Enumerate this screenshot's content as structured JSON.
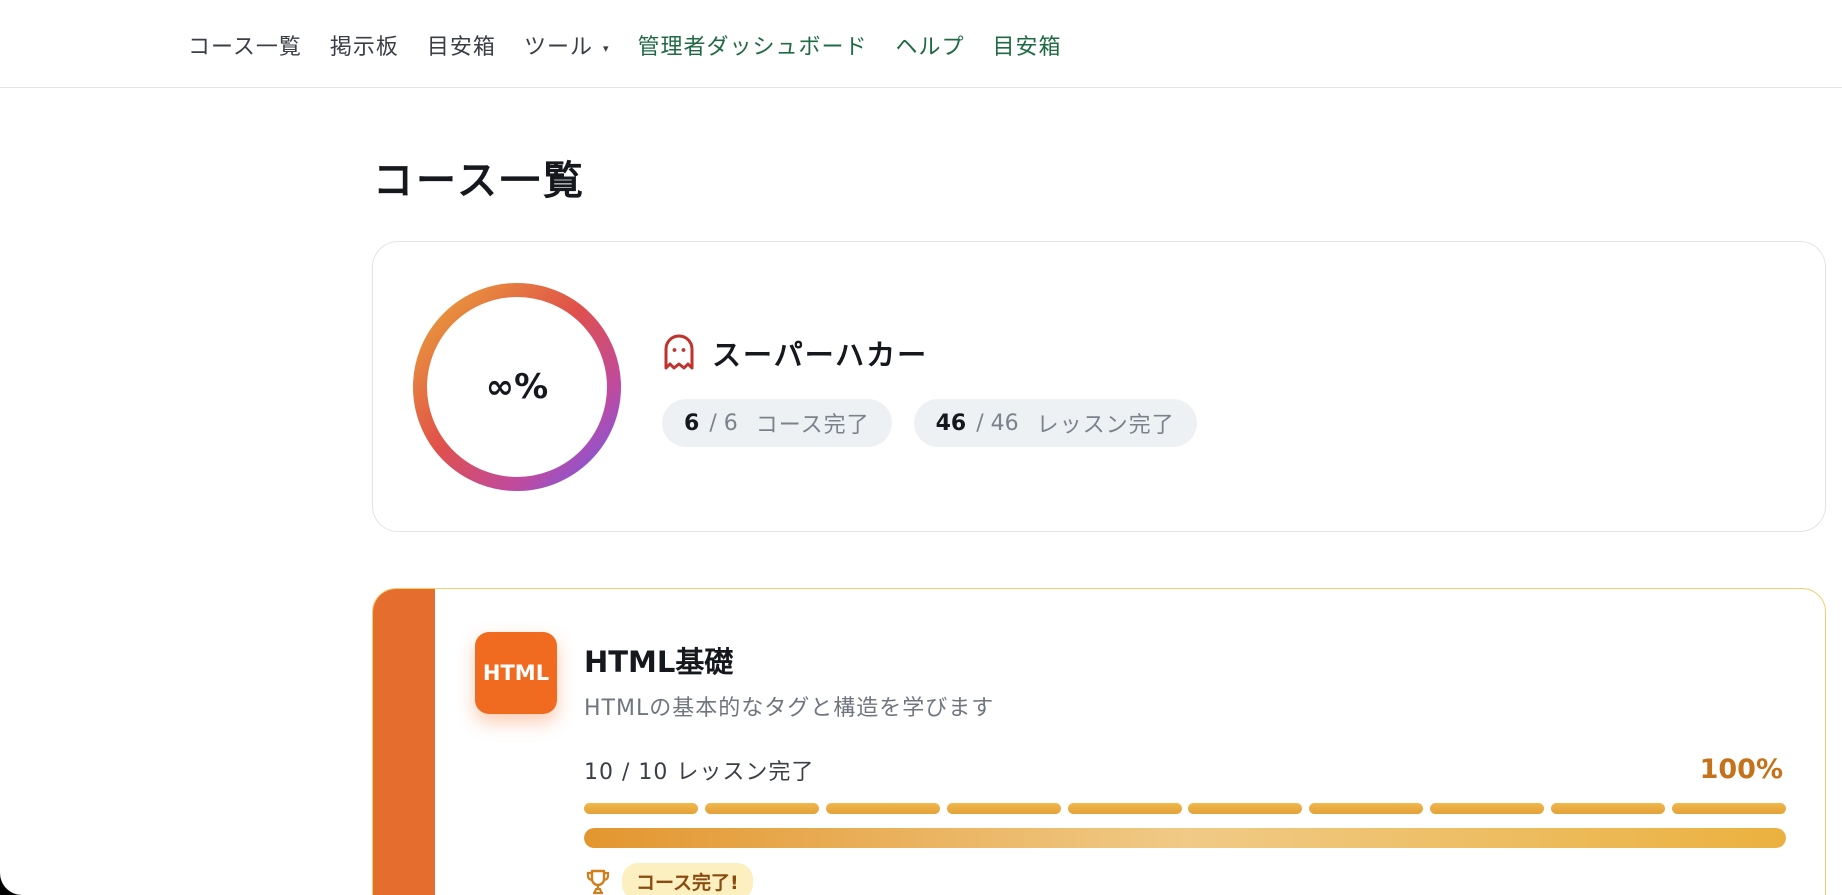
{
  "nav": {
    "items": [
      {
        "label": "コース一覧"
      },
      {
        "label": "掲示板"
      },
      {
        "label": "目安箱"
      },
      {
        "label": "ツール"
      },
      {
        "label": "管理者ダッシュボード"
      },
      {
        "label": "ヘルプ"
      },
      {
        "label": "目安箱"
      }
    ],
    "dropdown_caret": "▾"
  },
  "page": {
    "title": "コース一覧"
  },
  "summary": {
    "ring_label": "∞%",
    "ring_progress": 1.0,
    "rank_title": "スーパーハカー",
    "rank_icon": "ghost-icon",
    "courses": {
      "done": "6",
      "total": "/ 6",
      "label": "コース完了"
    },
    "lessons": {
      "done": "46",
      "total": "/ 46",
      "label": "レッスン完了"
    }
  },
  "course": {
    "badge": "HTML",
    "title": "HTML基礎",
    "description": "HTMLの基本的なタグと構造を学びます",
    "lessons_text": "10 / 10 レッスン完了",
    "percent_text": "100%",
    "progress": 1.0,
    "segments_total": 10,
    "segments_done": 10,
    "completed_label": "コース完了!",
    "completed_icon": "trophy-icon"
  },
  "colors": {
    "nav_green": "#1f6a43",
    "course_stripe": "#e56d2e",
    "course_badge": "#f06b1f",
    "percent_orange": "#c6711b",
    "progress_gold": "#ebb13f",
    "ring_gradient_start": "#e8a23a",
    "ring_gradient_end": "#6a5cf0"
  }
}
